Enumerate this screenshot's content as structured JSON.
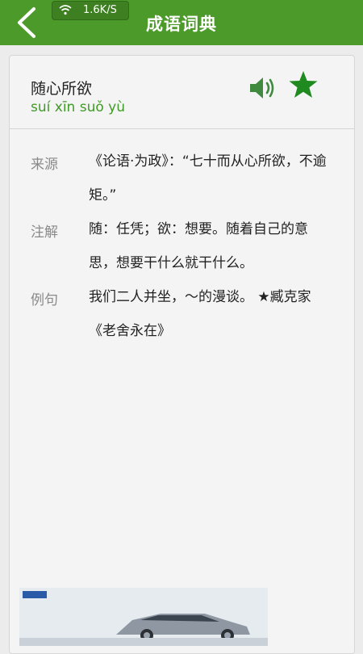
{
  "header": {
    "title": "成语词典",
    "network_speed": "1.6K/S"
  },
  "entry": {
    "word": "随心所欲",
    "pinyin": "suí xīn suǒ yù",
    "source_label": "来源",
    "source_text": "《论语·为政》：“七十而从心所欲，不逾矩。”",
    "explanation_label": "注解",
    "explanation_text": "随：任凭；欲：想要。随着自己的意思，想要干什么就干什么。",
    "example_label": "例句",
    "example_text": "我们二人并坐，～的漫谈。 ★臧克家《老舍永在》"
  },
  "colors": {
    "header_bg": "#4c9a2a",
    "accent_green": "#3f9a26",
    "star_green": "#1f8a1f"
  },
  "icons": [
    "back-arrow-icon",
    "wifi-icon",
    "speaker-icon",
    "star-icon"
  ]
}
